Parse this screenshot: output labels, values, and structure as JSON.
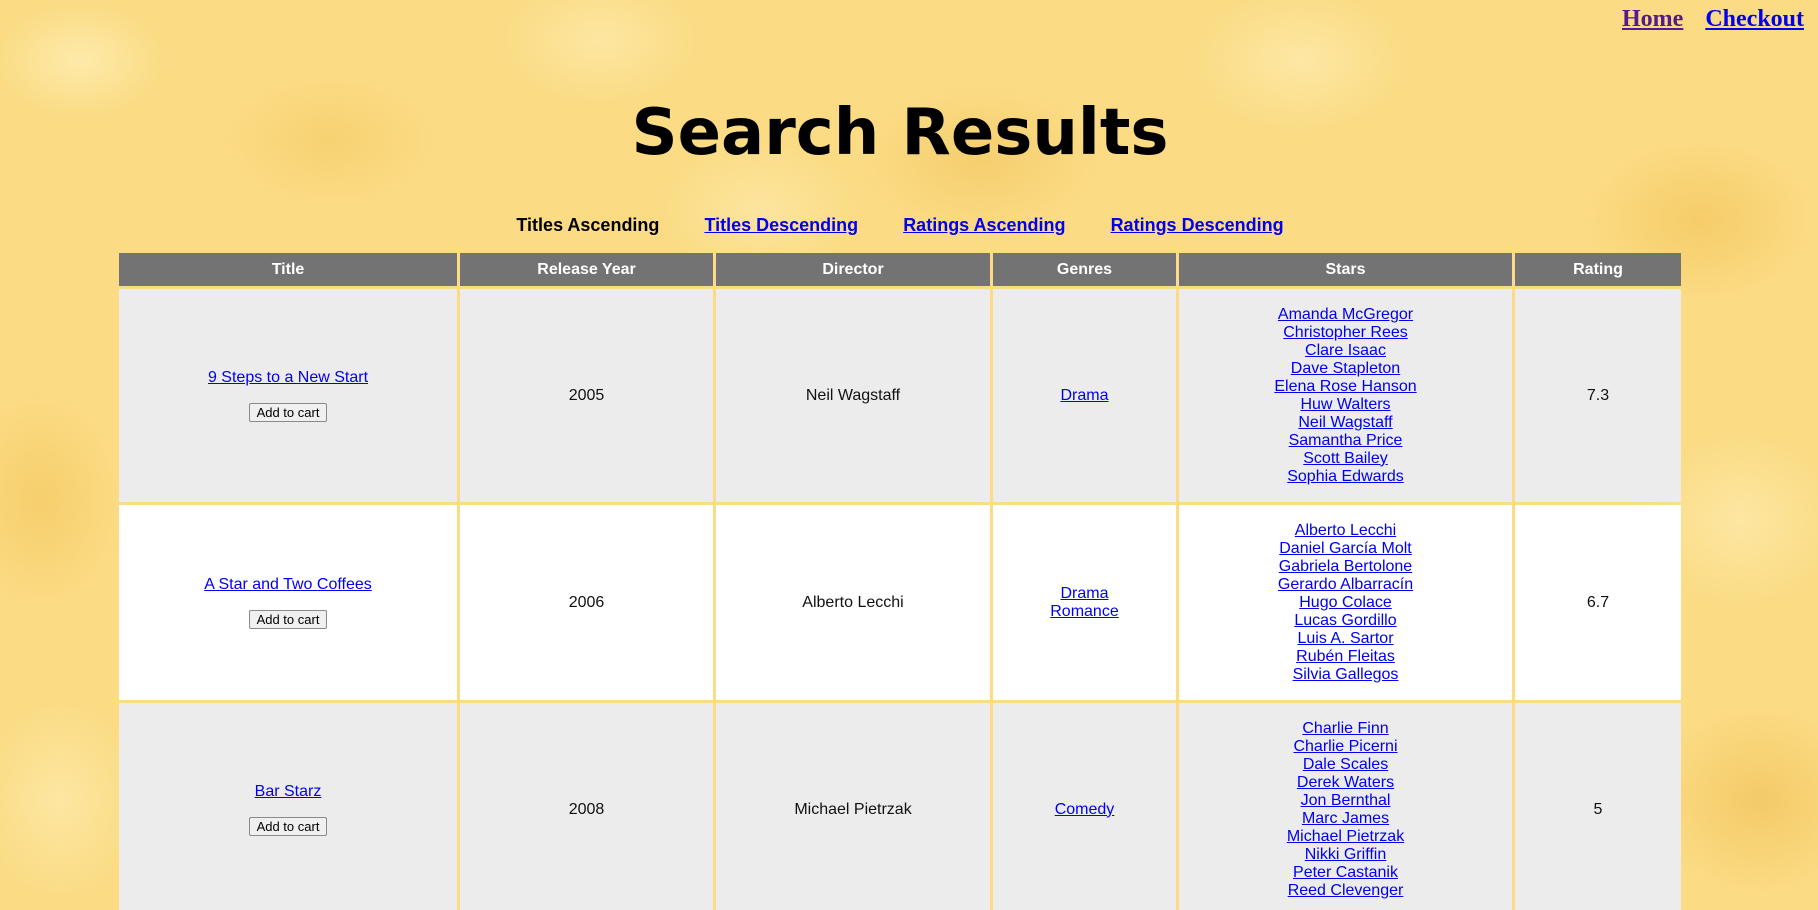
{
  "nav": {
    "home": "Home",
    "checkout": "Checkout"
  },
  "page_title": "Search Results",
  "sort": {
    "titles_asc": "Titles Ascending",
    "titles_desc": "Titles Descending",
    "ratings_asc": "Ratings Ascending",
    "ratings_desc": "Ratings Descending"
  },
  "table": {
    "headers": [
      "Title",
      "Release Year",
      "Director",
      "Genres",
      "Stars",
      "Rating"
    ],
    "add_to_cart_label": "Add to cart",
    "rows": [
      {
        "title": "9 Steps to a New Start",
        "year": "2005",
        "director": "Neil Wagstaff",
        "genres": [
          "Drama"
        ],
        "stars": [
          "Amanda McGregor",
          "Christopher Rees",
          "Clare Isaac",
          "Dave Stapleton",
          "Elena Rose Hanson",
          "Huw Walters",
          "Neil Wagstaff",
          "Samantha Price",
          "Scott Bailey",
          "Sophia Edwards"
        ],
        "rating": "7.3"
      },
      {
        "title": "A Star and Two Coffees",
        "year": "2006",
        "director": "Alberto Lecchi",
        "genres": [
          "Drama",
          "Romance"
        ],
        "stars": [
          "Alberto Lecchi",
          "Daniel García Molt",
          "Gabriela Bertolone",
          "Gerardo Albarracín",
          "Hugo Colace",
          "Lucas Gordillo",
          "Luis A. Sartor",
          "Rubén Fleitas",
          "Silvia Gallegos"
        ],
        "rating": "6.7"
      },
      {
        "title": "Bar Starz",
        "year": "2008",
        "director": "Michael Pietrzak",
        "genres": [
          "Comedy"
        ],
        "stars": [
          "Charlie Finn",
          "Charlie Picerni",
          "Dale Scales",
          "Derek Waters",
          "Jon Bernthal",
          "Marc James",
          "Michael Pietrzak",
          "Nikki Griffin",
          "Peter Castanik",
          "Reed Clevenger"
        ],
        "rating": "5"
      }
    ]
  }
}
